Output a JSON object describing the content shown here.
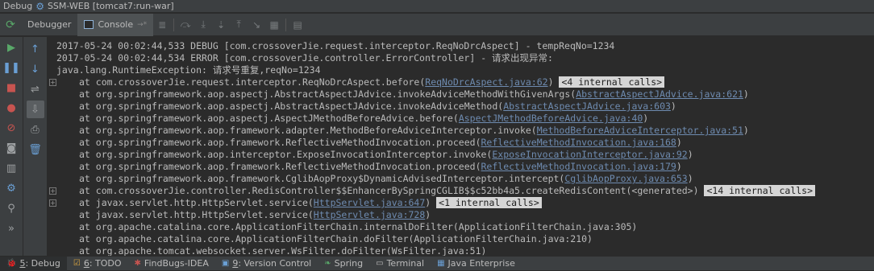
{
  "titlebar": {
    "prefix": "Debug",
    "config": "SSM-WEB [tomcat7:run-war]"
  },
  "tabs": [
    {
      "label": "Debugger"
    },
    {
      "label": "Console",
      "pin": "→*"
    }
  ],
  "console_lines": [
    {
      "text": "2017-05-24 00:02:44,533 DEBUG [com.crossoverJie.request.interceptor.ReqNoDrcAspect] - tempReqNo=1234"
    },
    {
      "text": "2017-05-24 00:02:44,534 ERROR [com.crossoverJie.controller.ErrorController] - 请求出现异常:"
    },
    {
      "text": "java.lang.RuntimeException: 请求号重复,reqNo=1234"
    },
    {
      "pre": "at com.crossoverJie.request.interceptor.ReqNoDrcAspect.before(",
      "link": "ReqNoDrcAspect.java:62",
      "post": ")",
      "badge": "<4 internal calls>"
    },
    {
      "pre": "at org.springframework.aop.aspectj.AbstractAspectJAdvice.invokeAdviceMethodWithGivenArgs(",
      "link": "AbstractAspectJAdvice.java:621",
      "post": ")"
    },
    {
      "pre": "at org.springframework.aop.aspectj.AbstractAspectJAdvice.invokeAdviceMethod(",
      "link": "AbstractAspectJAdvice.java:603",
      "post": ")"
    },
    {
      "pre": "at org.springframework.aop.aspectj.AspectJMethodBeforeAdvice.before(",
      "link": "AspectJMethodBeforeAdvice.java:40",
      "post": ")"
    },
    {
      "pre": "at org.springframework.aop.framework.adapter.MethodBeforeAdviceInterceptor.invoke(",
      "link": "MethodBeforeAdviceInterceptor.java:51",
      "post": ")"
    },
    {
      "pre": "at org.springframework.aop.framework.ReflectiveMethodInvocation.proceed(",
      "link": "ReflectiveMethodInvocation.java:168",
      "post": ")"
    },
    {
      "pre": "at org.springframework.aop.interceptor.ExposeInvocationInterceptor.invoke(",
      "link": "ExposeInvocationInterceptor.java:92",
      "post": ")"
    },
    {
      "pre": "at org.springframework.aop.framework.ReflectiveMethodInvocation.proceed(",
      "link": "ReflectiveMethodInvocation.java:179",
      "post": ")"
    },
    {
      "pre": "at org.springframework.aop.framework.CglibAopProxy$DynamicAdvisedInterceptor.intercept(",
      "link": "CglibAopProxy.java:653",
      "post": ")"
    },
    {
      "pre": "at com.crossoverJie.controller.RedisController$$EnhancerBySpringCGLIB$$c52bb4a5.createRedisContent(<generated>)",
      "badge": "<14 internal calls>"
    },
    {
      "pre": "at javax.servlet.http.HttpServlet.service(",
      "link": "HttpServlet.java:647",
      "post": ")",
      "badge": "<1 internal calls>"
    },
    {
      "pre": "at javax.servlet.http.HttpServlet.service(",
      "link": "HttpServlet.java:728",
      "post": ")"
    },
    {
      "pre": "at org.apache.catalina.core.ApplicationFilterChain.internalDoFilter(ApplicationFilterChain.java:305)"
    },
    {
      "pre": "at org.apache.catalina.core.ApplicationFilterChain.doFilter(ApplicationFilterChain.java:210)"
    },
    {
      "pre": "at org.apache.tomcat.websocket.server.WsFilter.doFilter(WsFilter.java:51)"
    }
  ],
  "statusbar": [
    {
      "num": "5",
      "label": ": Debug",
      "icon": "bug-icon"
    },
    {
      "num": "6",
      "label": ": TODO",
      "icon": "todo-icon"
    },
    {
      "num": "",
      "label": "FindBugs-IDEA",
      "icon": "findbugs-icon"
    },
    {
      "num": "9",
      "label": ": Version Control",
      "icon": "vcs-icon"
    },
    {
      "num": "",
      "label": "Spring",
      "icon": "spring-icon"
    },
    {
      "num": "",
      "label": "Terminal",
      "icon": "terminal-icon"
    },
    {
      "num": "",
      "label": "Java Enterprise",
      "icon": "java-ee-icon"
    }
  ]
}
